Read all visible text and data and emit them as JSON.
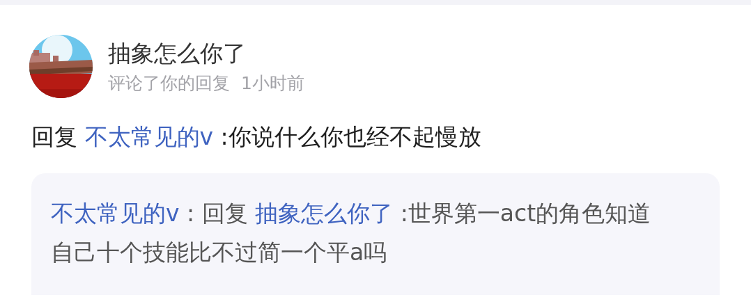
{
  "notification": {
    "user_name": "抽象怎么你了",
    "action": "评论了你的回复",
    "time": "1小时前"
  },
  "reply": {
    "prefix": "回复",
    "mention": "不太常见的v",
    "text": ":你说什么你也经不起慢放"
  },
  "quoted": {
    "author": "不太常见的v",
    "separator": ":",
    "prefix": "回复",
    "mention": "抽象怎么你了",
    "text": ":世界第一act的角色知道自己十个技能比不过简一个平a吗"
  }
}
